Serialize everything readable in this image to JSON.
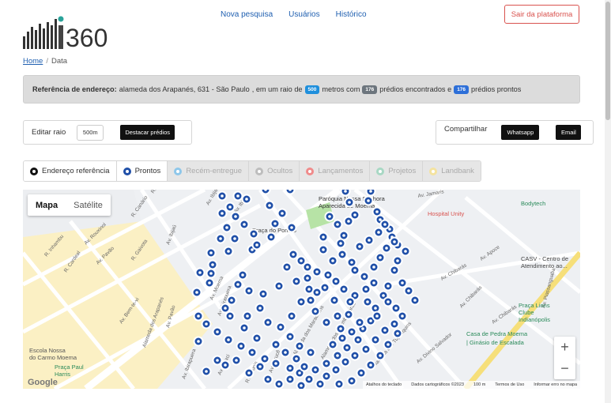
{
  "header": {
    "logo_text": "i360",
    "nav": [
      "Nova pesquisa",
      "Usuários",
      "Histórico"
    ],
    "logout_label": "Sair da plataforma"
  },
  "breadcrumb": {
    "home": "Home",
    "current": "Data"
  },
  "info": {
    "label": "Referência de endereço:",
    "address": "alameda dos Arapanés, 631 - São Paulo",
    "text_radius": ", em um raio de",
    "radius": "500",
    "text_with": "metros com",
    "found": "176",
    "text_found": "prédios encontrados e",
    "ready": "176",
    "text_ready": "prédios prontos"
  },
  "controls": {
    "edit_radius_label": "Editar raio",
    "radius_value": "500m",
    "highlight_button": "Destacar prédios",
    "share_label": "Compartilhar",
    "whatsapp_button": "Whatsapp",
    "email_button": "Email"
  },
  "tabs": [
    {
      "label": "Endereço referência",
      "color": "#111111",
      "active": true
    },
    {
      "label": "Prontos",
      "color": "#1f4fa8",
      "active": true
    },
    {
      "label": "Recém-entregue",
      "color": "#8ec7ea",
      "active": false
    },
    {
      "label": "Ocultos",
      "color": "#bdbdbd",
      "active": false
    },
    {
      "label": "Lançamentos",
      "color": "#f08b8b",
      "active": false
    },
    {
      "label": "Projetos",
      "color": "#a8d8c4",
      "active": false
    },
    {
      "label": "Landbank",
      "color": "#f4e3a0",
      "active": false
    }
  ],
  "map": {
    "type_map": "Mapa",
    "type_satellite": "Satélite",
    "zoom_in": "+",
    "zoom_out": "−",
    "google": "Google",
    "attribution": [
      "Atalhos do teclado",
      "Dados cartográficos ©2023",
      "100 m",
      "Termos de Uso",
      "Informar erro no mapa"
    ],
    "street_labels": [
      "R. Canário",
      "Av. Rouxinol",
      "R. Inhambu",
      "Av. Pavão",
      "R. Gaivota",
      "R. Cardeal",
      "Av. Ibijaú",
      "Av. Bem-te-vi",
      "Alameda dos Arapanés",
      "Av. Pavão",
      "Av. Ibirapuera",
      "Av. Ibirapuera",
      "Av. Moaci",
      "Av. Moema",
      "R. Jurupis",
      "Av. Jurucê",
      "Alameda dos Maracatins",
      "Alameda dos Nhambiquaras",
      "Alameda dos Tupiniquins",
      "Av. Divino Salvador",
      "Av. Chibarás",
      "Av. Chibarás",
      "Av. Chibarás",
      "Av. Piassanguaba",
      "Av. Apoce",
      "Av. Ibijaú",
      "Av. Ibijaú",
      "R. Canário",
      "Av. Jamaris"
    ],
    "pois": [
      "Paróquia Nossa Senhora Aparecida de Moema",
      "Praça do Pombo",
      "Hospital Unity",
      "Bodytech",
      "CASV - Centro de Atendimento ao...",
      "Praça Lions Clube Indianópolis",
      "Casa de Pedra Moema | Ginásio de Escalada",
      "Praça Paul Harris",
      "Escola Nossa Senhora do Carmo Moema"
    ],
    "poi_names": [
      "Paróquia Nossa Senhora",
      "Aparecida de Moema",
      "Praça do Pombo",
      "Hospital Unity",
      "Bodytech",
      "CASV - Centro de",
      "Atendimento ao...",
      "Praça Lions",
      "Clube",
      "Indianópolis",
      "Casa de Pedra Moema",
      "| Ginásio de Escalada",
      "Praça Paul",
      "Harris",
      "Escola Nossa",
      "do Carmo Moema"
    ]
  }
}
